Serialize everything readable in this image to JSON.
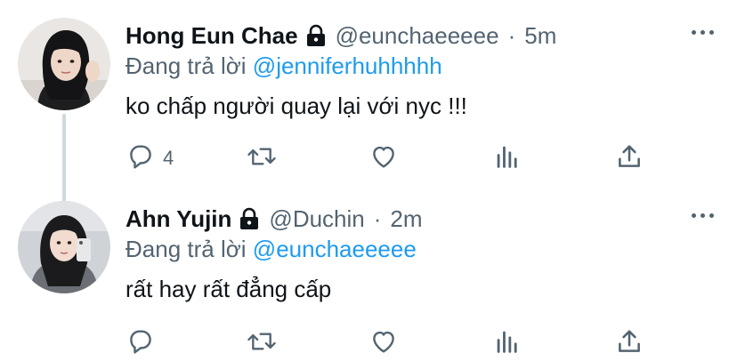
{
  "tweets": [
    {
      "name": "Hong Eun Chae",
      "handle": "@eunchaeeeee",
      "separator": "·",
      "time": "5m",
      "reply_prefix": "Đang trả lời",
      "reply_to": "@jenniferhuhhhhh",
      "text": "ko chấp người quay lại với nyc !!!",
      "reply_count": "4",
      "locked": true
    },
    {
      "name": "Ahn Yujin",
      "handle": "@Duchin",
      "separator": "·",
      "time": "2m",
      "reply_prefix": "Đang trả lời",
      "reply_to": "@eunchaeeeee",
      "text": "rất hay rất đẳng cấp",
      "reply_count": "",
      "locked": true
    }
  ],
  "icons": {
    "reply": "speech-bubble",
    "retweet": "retweet-arrows",
    "like": "heart",
    "stats": "bar-chart",
    "share": "upload-arrow",
    "more": "three-dots",
    "lock": "padlock"
  },
  "colors": {
    "text": "#0f1419",
    "secondary": "#536471",
    "link": "#1d9bf0",
    "thread_line": "#cfd9de"
  }
}
